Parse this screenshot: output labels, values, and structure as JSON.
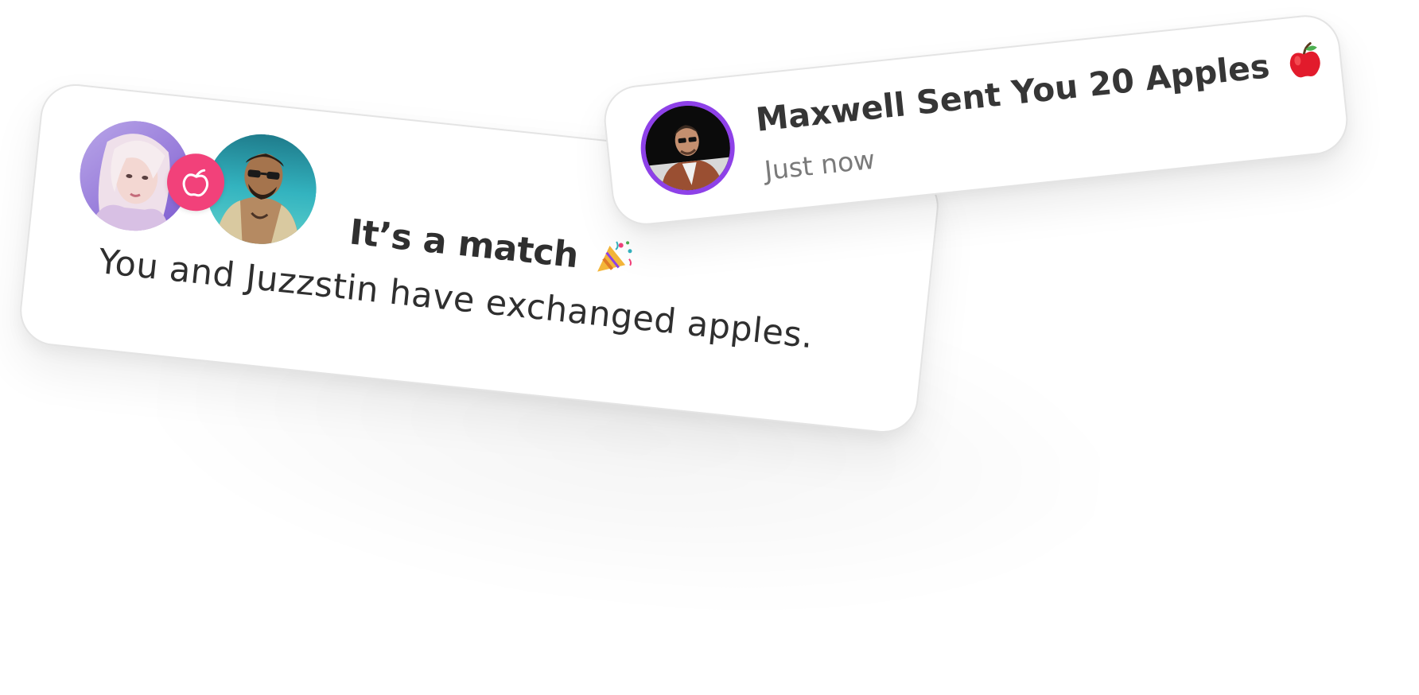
{
  "match_card": {
    "title": "It’s a match",
    "title_emoji": "party-popper-icon",
    "body": "You and Juzzstin have exchanged apples.",
    "badge_icon": "apple-outline-icon",
    "badge_color": "#f2417a",
    "avatars": [
      "avatar-woman",
      "avatar-man-tattoo"
    ]
  },
  "notification": {
    "title": "Maxwell Sent You 20 Apples",
    "title_emoji": "red-apple-icon",
    "time": "Just now",
    "avatar_ring_color": "#8e41e8",
    "avatar": "avatar-maxwell"
  }
}
